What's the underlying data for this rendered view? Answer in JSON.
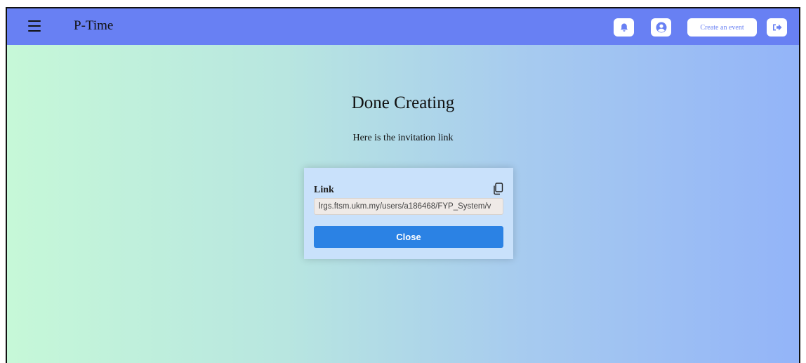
{
  "navbar": {
    "brand": "P-Time",
    "create_event_label": "Create an event",
    "icons": [
      "menu-icon",
      "bell-icon",
      "user-icon",
      "logout-icon"
    ],
    "color": "#6880f3"
  },
  "main": {
    "heading": "Done Creating",
    "subtext": "Here is the invitation link"
  },
  "card": {
    "label": "Link",
    "link_value": "lrgs.ftsm.ukm.my/users/a186468/FYP_System/v",
    "close_label": "Close",
    "button_color": "#2b82e4"
  }
}
